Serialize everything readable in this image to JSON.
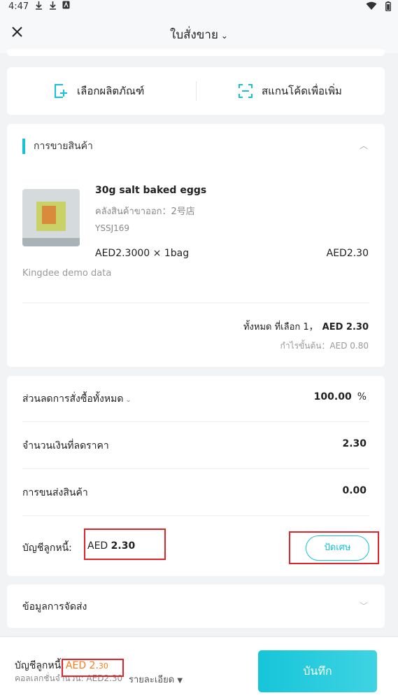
{
  "status_bar": {
    "time": "4:47",
    "icons_left": [
      "download-icon",
      "download-icon",
      "app-icon"
    ],
    "icons_right": [
      "wifi-icon",
      "battery-icon"
    ]
  },
  "header": {
    "title": "ใบสั่งขาย",
    "close_icon": "close-icon",
    "title_chevron": "chevron-down-icon"
  },
  "actions": {
    "select_product": "เลือกผลิตภัณฑ์",
    "scan_code": "สแกนโค้ดเพื่อเพิ่ม"
  },
  "sales_section": {
    "title": "การขายสินค้า",
    "product": {
      "name": "30g salt baked eggs",
      "warehouse": "คลังสินค้าขาออก：2号店",
      "code": "YSSJ169",
      "unit_price_qty": "AED2.3000 × 1bag",
      "amount": "AED2.30"
    },
    "note": "Kingdee demo data",
    "total_selected_label": "ทั้งหมด ที่เลือก 1，",
    "total_selected_amount": "AED 2.30",
    "profit": "กำไรขั้นต้น：AED 0.80"
  },
  "summary": {
    "discount_label": "ส่วนลดการสั่งซื้อทั้งหมด",
    "discount_value": "100.00",
    "discount_unit": "%",
    "discounted_amount_label": "จำนวนเงินที่ลดราคา",
    "discounted_amount_value": "2.30",
    "shipping_fee_label": "การขนส่งสินค้า",
    "shipping_fee_value": "0.00",
    "receivable_label": "บัญชีลูกหนี้:",
    "receivable_currency": "AED",
    "receivable_value": "2.30",
    "round_off_button": "ปัดเศษ"
  },
  "shipping_info": {
    "label": "ข้อมูลการจัดส่ง"
  },
  "footer": {
    "receivable_label": "บัญชีลูกหนี้:",
    "receivable_amount_main": "AED 2.",
    "receivable_amount_cents": "30",
    "collected_label": "คอลเลกชั่นจำนวน: AED2.30",
    "detail_label": "รายละเอียด",
    "save_button": "บันทึก"
  },
  "colors": {
    "accent": "#17c2d6",
    "highlight_box": "#e0242a",
    "amount_orange": "#ff7a1a"
  }
}
